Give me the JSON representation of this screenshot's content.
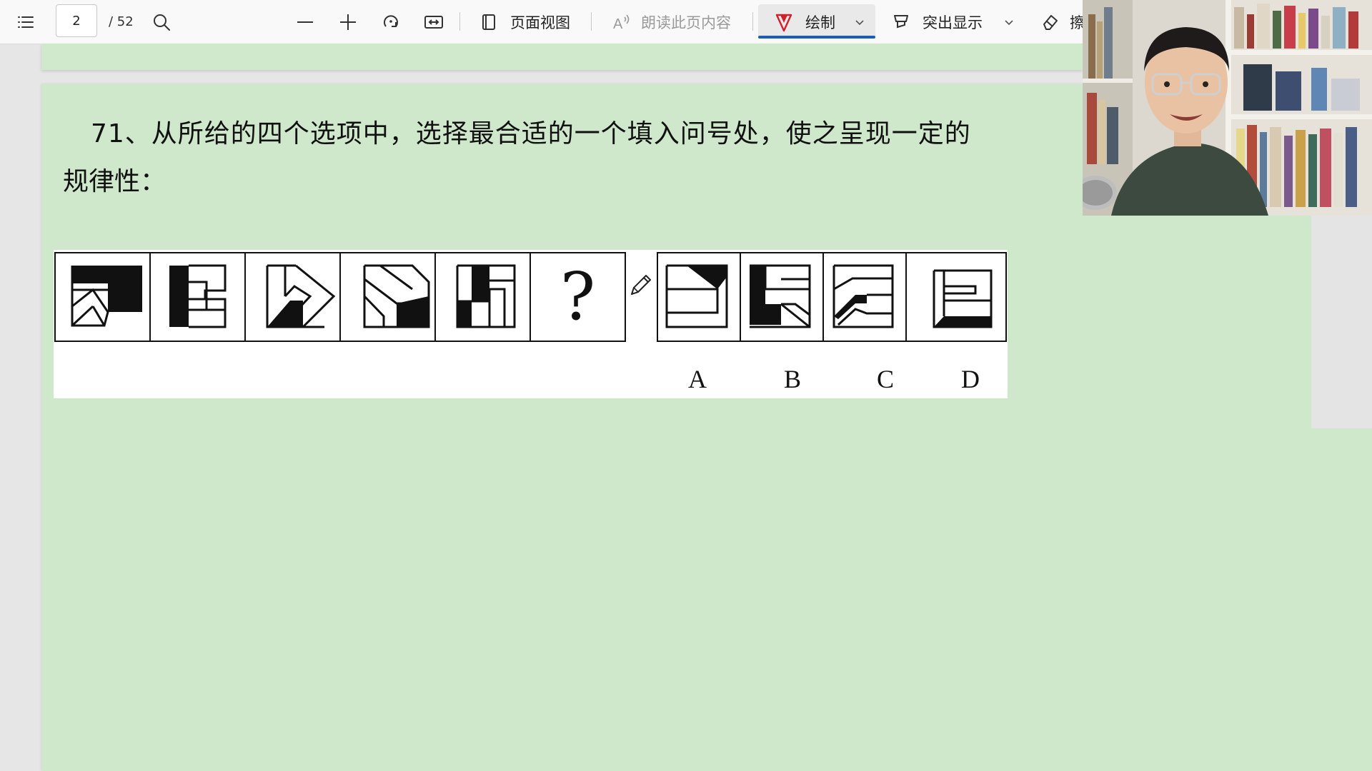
{
  "toolbar": {
    "page_number": "2",
    "page_total": "/ 52",
    "page_view_label": "页面视图",
    "read_aloud_label": "朗读此页内容",
    "draw_label": "绘制",
    "highlight_label": "突出显示",
    "erase_label": "擦",
    "accent_color": "#1a5fb4",
    "draw_icon_color": "#d21f2b"
  },
  "document": {
    "question_line1": "71、从所给的四个选项中，选择最合适的一个填入问号处，使之呈现一定的",
    "question_line2": "规律性：",
    "background_color": "#cfe8cc"
  },
  "puzzle": {
    "question_mark": "?",
    "options": [
      "A",
      "B",
      "C",
      "D"
    ]
  }
}
